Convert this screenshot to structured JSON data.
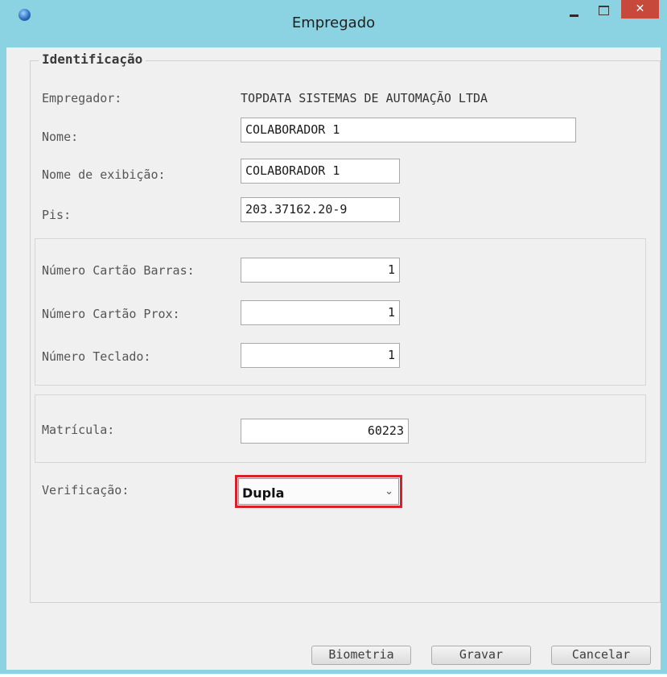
{
  "window": {
    "title": "Empregado",
    "close_glyph": "✕",
    "icons": [
      "app-globe-icon",
      "minimize-icon",
      "maximize-icon",
      "close-icon"
    ]
  },
  "identificacao": {
    "legend": "Identificação",
    "empregador_label": "Empregador:",
    "empregador_value": "TOPDATA SISTEMAS DE AUTOMAÇÃO LTDA",
    "nome_label": "Nome:",
    "nome_value": "COLABORADOR 1",
    "nome_exibicao_label": "Nome de exibição:",
    "nome_exibicao_value": "COLABORADOR 1",
    "pis_label": "Pis:",
    "pis_value": "203.37162.20-9"
  },
  "cartoes": {
    "barras_label": "Número Cartão Barras:",
    "barras_value": "1",
    "prox_label": "Número Cartão Prox:",
    "prox_value": "1",
    "teclado_label": "Número Teclado:",
    "teclado_value": "1"
  },
  "matricula": {
    "label": "Matrícula:",
    "value": "60223"
  },
  "verificacao": {
    "label": "Verificação:",
    "selected": "Dupla",
    "chevron": "⌄",
    "highlight_color": "#d9202a"
  },
  "buttons": {
    "biometria": "Biometria",
    "gravar": "Gravar",
    "cancelar": "Cancelar"
  },
  "colors": {
    "title_bar": "#8bd3e3",
    "close_button": "#c7493c",
    "client_bg": "#f0f0f0"
  }
}
